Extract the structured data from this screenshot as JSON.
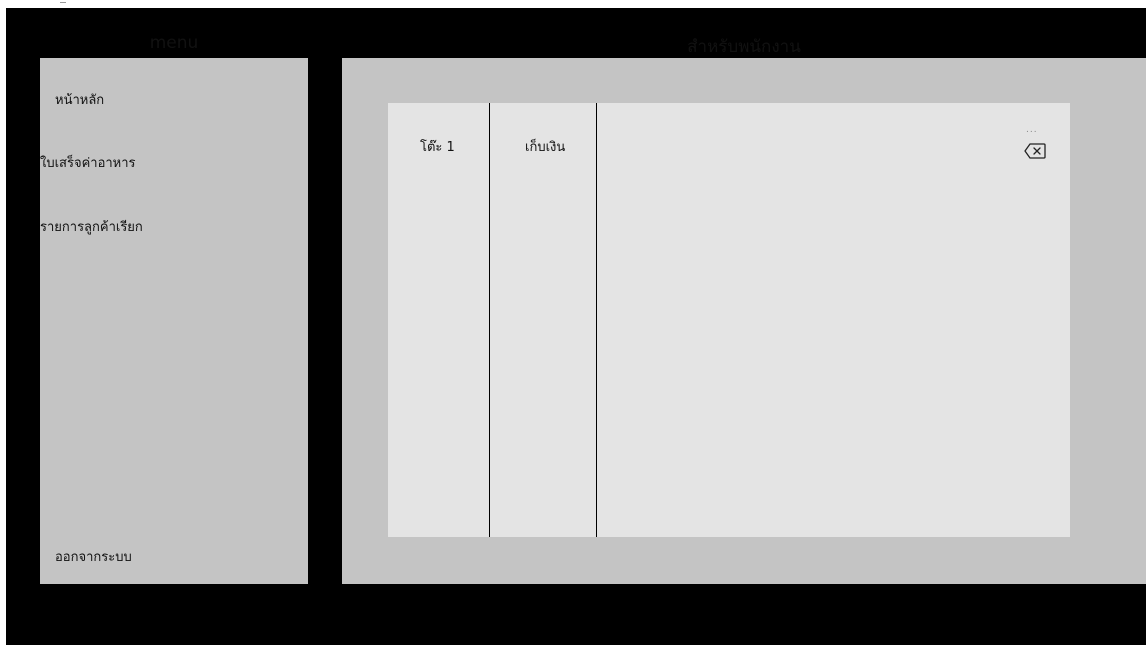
{
  "sidebar": {
    "title": "menu",
    "items": [
      {
        "label": "หน้าหลัก"
      },
      {
        "label": "ใบเสร็จค่าอาหาร"
      },
      {
        "label": "รายการลูกค้าเรียก"
      }
    ],
    "logout_label": "ออกจากระบบ"
  },
  "main": {
    "title": "สำหรับพนักงาน",
    "table_label": "โต๊ะ 1",
    "checkout_label": "เก็บเงิน",
    "more_label": "...",
    "delete_icon": "backspace-icon"
  },
  "colors": {
    "panel": "#c4c4c4",
    "card": "#e4e4e4",
    "frame": "#000000"
  }
}
